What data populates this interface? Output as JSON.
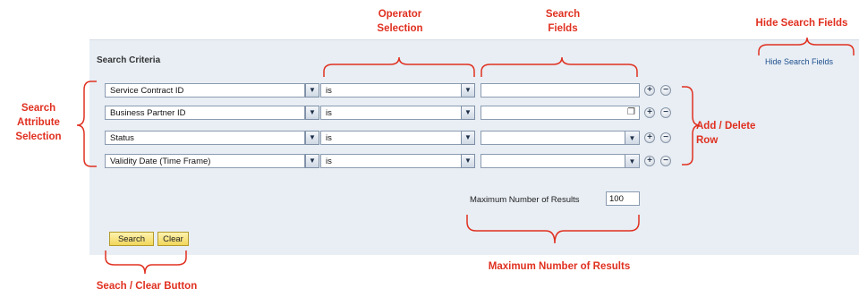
{
  "annotations": {
    "operator_selection": "Operator\nSelection",
    "search_fields": "Search\nFields",
    "hide_search_fields": "Hide Search Fields",
    "search_attribute_selection": "Search\nAttribute\nSelection",
    "add_delete_row": "Add / Delete\nRow",
    "maximum_number_of_results": "Maximum Number of Results",
    "search_clear_button": "Seach / Clear Button"
  },
  "panel": {
    "title": "Search Criteria",
    "hide_link": "Hide Search Fields"
  },
  "rows": [
    {
      "attribute": "Service Contract ID",
      "operator": "is",
      "field_type": "text",
      "value": ""
    },
    {
      "attribute": "Business Partner ID",
      "operator": "is",
      "field_type": "value-help",
      "value": ""
    },
    {
      "attribute": "Status",
      "operator": "is",
      "field_type": "dropdown",
      "value": ""
    },
    {
      "attribute": "Validity Date (Time Frame)",
      "operator": "is",
      "field_type": "dropdown",
      "value": ""
    }
  ],
  "max_results": {
    "label": "Maximum Number of Results",
    "value": "100"
  },
  "buttons": {
    "search": "Search",
    "clear": "Clear"
  },
  "colors": {
    "annotation": "#e03020",
    "panel": "#e8eef4",
    "link": "#1f4f8f",
    "button": "#f0d65a"
  }
}
